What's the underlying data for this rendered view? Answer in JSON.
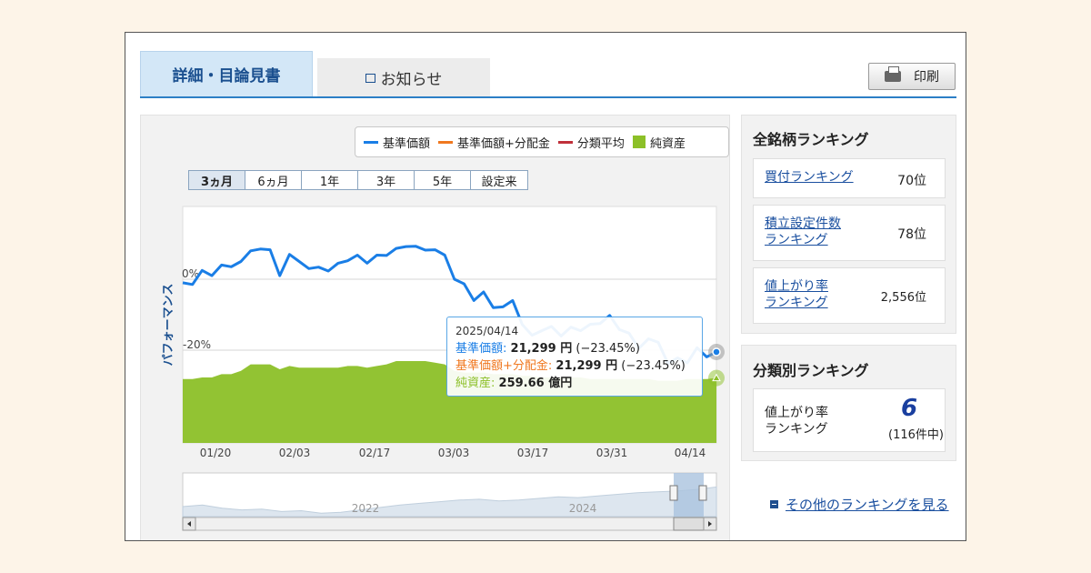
{
  "tabs": {
    "detail": "詳細・目論見書",
    "news": "お知らせ"
  },
  "print_label": "印刷",
  "legend": [
    {
      "label": "基準価額",
      "color": "#1a7ee6",
      "kind": "line"
    },
    {
      "label": "基準価額+分配金",
      "color": "#f07820",
      "kind": "line"
    },
    {
      "label": "分類平均",
      "color": "#c0303a",
      "kind": "line"
    },
    {
      "label": "純資産",
      "color": "#8cc028",
      "kind": "box"
    }
  ],
  "periods": [
    "3ヵ月",
    "6ヵ月",
    "1年",
    "3年",
    "5年",
    "設定来"
  ],
  "selected_period": "3ヵ月",
  "chart_data": {
    "type": "line",
    "ylabel": "パフォーマンス",
    "y_ticks": [
      "0%",
      "-20%"
    ],
    "x_ticks": [
      "01/20",
      "02/03",
      "02/17",
      "03/03",
      "03/17",
      "03/31",
      "04/14"
    ],
    "series": [
      {
        "name": "基準価額",
        "color": "#1a7ee6",
        "values": [
          -1,
          -1.5,
          2.5,
          1,
          4,
          3.5,
          5,
          8,
          8.5,
          8.3,
          1,
          7,
          5,
          3,
          3.4,
          2.3,
          4.5,
          5.2,
          6.8,
          4.5,
          6.8,
          6.7,
          8.7,
          9.2,
          9.3,
          8.2,
          8.3,
          6.8,
          0,
          -1.3,
          -6,
          -3.6,
          -8,
          -7.8,
          -6,
          -12.8,
          -15.8,
          -14.5,
          -13.3,
          -16,
          -13.5,
          -14.5,
          -12.7,
          -12.5,
          -10.2,
          -14.2,
          -15.2,
          -19.5,
          -16.8,
          -17.8,
          -23.7,
          -22.2,
          -23.6,
          -19.3,
          -21.9,
          -20.5
        ]
      },
      {
        "name": "純資産",
        "color": "#8cc028",
        "values": [
          259,
          259,
          260,
          260,
          262,
          262,
          264,
          268,
          268,
          268,
          265,
          267,
          266,
          266,
          266,
          266,
          266,
          267,
          267,
          266,
          267,
          268,
          270,
          270,
          270,
          270,
          269,
          268,
          264,
          263,
          263,
          263,
          262,
          262,
          262,
          261,
          261,
          260,
          260,
          260,
          260,
          260,
          259,
          259,
          259,
          259,
          259,
          259,
          259,
          258,
          258,
          258,
          259,
          259,
          259,
          259.66
        ]
      }
    ],
    "navigator_years": [
      "2022",
      "2024"
    ]
  },
  "tooltip": {
    "date": "2025/04/14",
    "nav_label": "基準価額:",
    "nav_value": "21,299 円",
    "nav_change": "(−23.45%)",
    "navdiv_label": "基準価額+分配金:",
    "navdiv_value": "21,299 円",
    "navdiv_change": "(−23.45%)",
    "assets_label": "純資産:",
    "assets_value": "259.66 億円"
  },
  "ranking_all": {
    "title": "全銘柄ランキング",
    "items": [
      {
        "label_line1": "買付ランキング",
        "label_line2": "",
        "value": "70位"
      },
      {
        "label_line1": "積立設定件数",
        "label_line2": "ランキング",
        "value": "78位"
      },
      {
        "label_line1": "値上がり率",
        "label_line2": "ランキング",
        "value": "2,556位"
      }
    ]
  },
  "ranking_category": {
    "title": "分類別ランキング",
    "label_line1": "値上がり率",
    "label_line2": "ランキング",
    "rank": "6",
    "total": "(116件中)"
  },
  "more_link": "その他のランキングを見る"
}
